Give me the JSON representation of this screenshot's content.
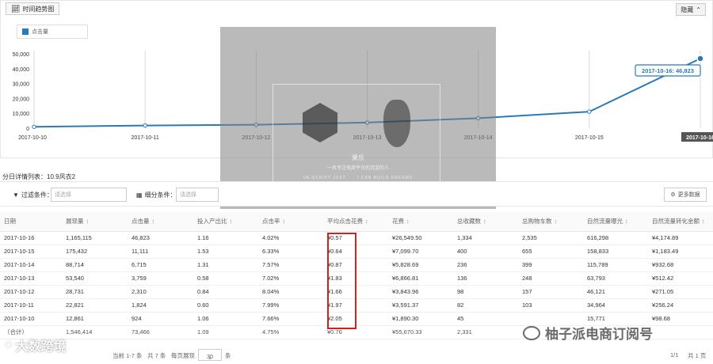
{
  "trend": {
    "tab_label": "时间趋势图",
    "collapse_label": "隐藏",
    "legend_label": "点击量"
  },
  "chart_data": {
    "type": "line",
    "x": [
      "2017-10-10",
      "2017-10-11",
      "2017-10-12",
      "2017-10-13",
      "2017-10-14",
      "2017-10-15",
      "2017-10-16"
    ],
    "series": [
      {
        "name": "点击量",
        "values": [
          924,
          1824,
          2310,
          3759,
          6715,
          11111,
          46823
        ],
        "color": "#2a7ab8"
      }
    ],
    "yticks": [
      "0",
      "10,000",
      "20,000",
      "30,000",
      "40,000",
      "50,000"
    ],
    "ylim": [
      0,
      50000
    ],
    "tooltip": "2017-10-16: 46,823",
    "highlight_x": "2017-10-16",
    "grid": "vertical"
  },
  "watermark": {
    "name": "果乐",
    "tagline": "一名专注电商平台的沉淀的人",
    "small_left": "VA-SCRIPT JUST",
    "small_right": "I CAN BUILD DREAMS"
  },
  "detail": {
    "subtitle": "分日详情列表：10.9风衣2",
    "filter_label": "过滤条件：",
    "filter_placeholder": "请选择",
    "subfilter_label": "细分条件：",
    "subfilter_placeholder": "请选择",
    "more_label": "更多数据",
    "columns": [
      "日期",
      "展现量",
      "点击量",
      "投入产出比",
      "点击率",
      "平均点击花费",
      "花费",
      "总收藏数",
      "总购物车数",
      "自然流量曝光",
      "自然流量转化金额"
    ],
    "rows": [
      [
        "2017-10-16",
        "1,165,115",
        "46,823",
        "1.16",
        "4.02%",
        "¥0.57",
        "¥26,549.50",
        "1,334",
        "2,535",
        "616,298",
        "¥4,174.89"
      ],
      [
        "2017-10-15",
        "175,432",
        "11,111",
        "1.53",
        "6.33%",
        "¥0.64",
        "¥7,099.70",
        "400",
        "655",
        "158,833",
        "¥1,183.49"
      ],
      [
        "2017-10-14",
        "88,714",
        "6,715",
        "1.31",
        "7.57%",
        "¥0.87",
        "¥5,828.69",
        "236",
        "399",
        "115,789",
        "¥932.68"
      ],
      [
        "2017-10-13",
        "53,540",
        "3,759",
        "0.58",
        "7.02%",
        "¥1.83",
        "¥6,866.81",
        "136",
        "248",
        "63,793",
        "¥512.42"
      ],
      [
        "2017-10-12",
        "28,731",
        "2,310",
        "0.84",
        "8.04%",
        "¥1.66",
        "¥3,843.96",
        "98",
        "157",
        "46,121",
        "¥271.05"
      ],
      [
        "2017-10-11",
        "22,821",
        "1,824",
        "0.60",
        "7.99%",
        "¥1.97",
        "¥3,591.37",
        "82",
        "103",
        "34,964",
        "¥256.24"
      ],
      [
        "2017-10-10",
        "12,861",
        "924",
        "1.06",
        "7.66%",
        "¥2.05",
        "¥1,890.30",
        "45",
        "",
        "15,771",
        "¥98.68"
      ],
      [
        "（合计）",
        "1,546,414",
        "73,466",
        "1.09",
        "4.75%",
        "¥0.76",
        "¥55,670.33",
        "2,331",
        "",
        "",
        ""
      ]
    ]
  },
  "pager": {
    "current": "当前 1-7 条",
    "total": "共 7 条",
    "per_page_label": "每页展现",
    "per_page_value": "30",
    "per_page_unit": "条",
    "pages": "1/1",
    "page_total": "共 1 页"
  },
  "logos": {
    "left": "大数跨境",
    "right": "柚子派电商订阅号"
  }
}
